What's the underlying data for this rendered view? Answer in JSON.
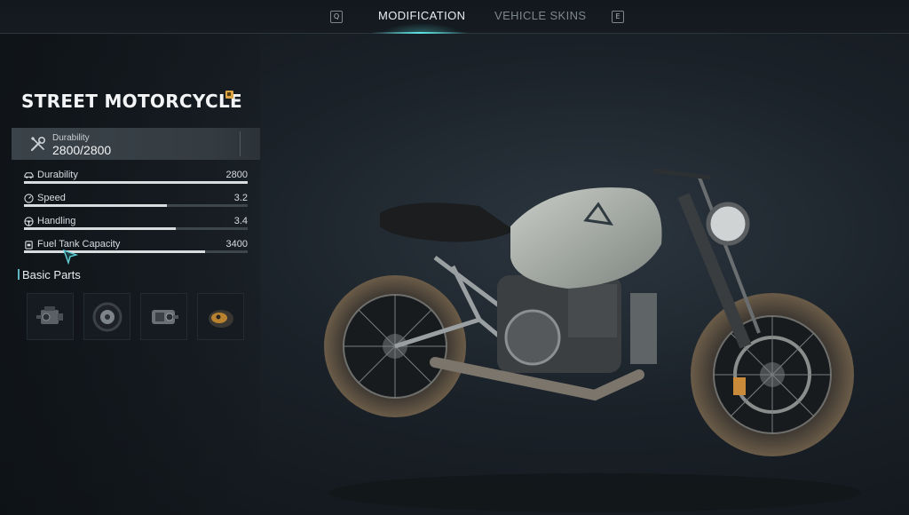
{
  "header": {
    "left_key": "Q",
    "right_key": "E",
    "tabs": [
      {
        "label": "MODIFICATION",
        "active": true
      },
      {
        "label": "VEHICLE SKINS",
        "active": false
      }
    ]
  },
  "vehicle": {
    "name": "STREET MOTORCYCLE",
    "rarity_icon": "rarity-badge-icon",
    "durability_card": {
      "icon": "wrench-screwdriver-icon",
      "label": "Durability",
      "value": "2800/2800"
    }
  },
  "stats": [
    {
      "icon": "car-icon",
      "label": "Durability",
      "value": "2800",
      "fill_fraction": 1.0
    },
    {
      "icon": "speedometer-icon",
      "label": "Speed",
      "value": "3.2",
      "fill_fraction": 0.64
    },
    {
      "icon": "steering-wheel-icon",
      "label": "Handling",
      "value": "3.4",
      "fill_fraction": 0.68
    },
    {
      "icon": "fuel-can-icon",
      "label": "Fuel Tank Capacity",
      "value": "3400",
      "fill_fraction": 0.81
    }
  ],
  "parts_section": {
    "title": "Basic Parts",
    "slots": [
      {
        "icon": "engine-part-icon"
      },
      {
        "icon": "tire-part-icon"
      },
      {
        "icon": "gearbox-part-icon"
      },
      {
        "icon": "fuel-tank-part-icon"
      }
    ]
  },
  "colors": {
    "accent": "#5fe3e3",
    "rarity": "#d9a441",
    "bar_fill": "#d8dcdf"
  }
}
